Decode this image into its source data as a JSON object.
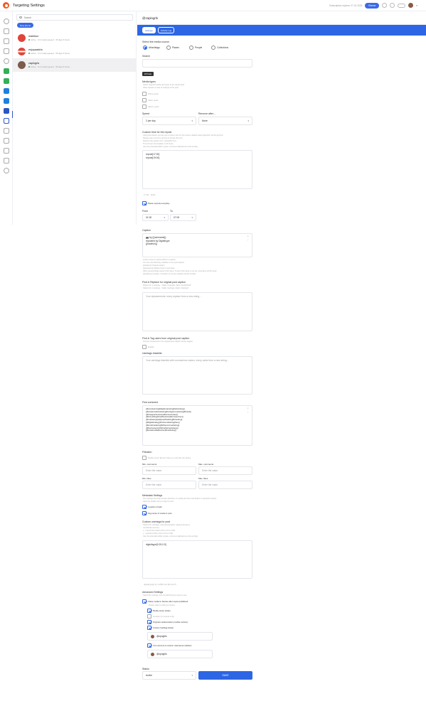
{
  "app": {
    "title": "Targeting Settings",
    "subscription_text": "Subscription expires: 07.01.2025",
    "renew_label": "Renew"
  },
  "colors": {
    "accent": "#2d66e4",
    "brand": "#f15a24",
    "success": "#31b057"
  },
  "sidebar": {
    "icons": [
      "plus-icon",
      "grid-icon",
      "layout-icon",
      "instagram-icon",
      "users-icon",
      "phone-icon",
      "whatsapp-icon",
      "telegram-icon",
      "facebook-icon",
      "messenger-icon",
      "twitter-icon",
      "target-icon",
      "heart-icon",
      "gift-icon",
      "reels-icon",
      "settings-icon"
    ]
  },
  "accounts_panel": {
    "search_placeholder": "Search",
    "add_button": "New phone",
    "items": [
      {
        "name": "malekun",
        "meta": "Active · 6 (in total) queued · 35 days 5 hours"
      },
      {
        "name": "enjoyaadria",
        "meta": "Active · 6 (in total) queued · 35 days 5 hours"
      },
      {
        "name": "zapingrls",
        "meta": "Active · 6 (in total) queued · 35 days 5 hours"
      }
    ]
  },
  "main": {
    "account_title": "@zapingrls",
    "tabs": [
      "Settings",
      "Activity Log"
    ],
    "media_source": {
      "label": "Select the media source:",
      "options": [
        "#Hashtags",
        "Places",
        "People",
        "Collections"
      ]
    },
    "search_label": "Search",
    "chip": "#zTrade",
    "media_types": {
      "label": "Media types",
      "hints": [
        "Select required media and types to the repost feed",
        "Allow reposts in case of settings of the post"
      ],
      "options": [
        "Photo posts",
        "Video posts",
        "Album posts"
      ]
    },
    "speed": {
      "label": "Speed",
      "value": "2 per day"
    },
    "remove_after": {
      "label": "Remove after...",
      "value": "None"
    },
    "custom_time": {
      "label": "Custom time for the repost",
      "hints": [
        "Using the feature you can set a custom time for the repost, default speed algorithm will be ignored",
        "Please enter one time per line in format (hh:mm)",
        "Respect the system time: repost[hh:mm]",
        "Time format: 24 template, 0-23 hours",
        "Use the extended editor syntax, comma is allowed as a line-ending"
      ],
      "value": "repost[17:00]\nrepost[19:00]",
      "note": "17:00 - 19:00"
    },
    "pause": {
      "label": "Pause reposts everyday...",
      "from_label": "From",
      "to_label": "To",
      "from_value": "01:00",
      "to_value": "07:00"
    },
    "caption": {
      "label": "Caption",
      "value": "📷 by {{username}}\nreposted by Digisthype\n{{location}}",
      "hints": [
        "Leave empty to repost without a caption",
        "You can use following variables in the post caption:",
        "{{caption}} Original caption",
        "{{username}} Media owner's username",
        "{{full_name}} Media owner's full name. If user's full name is not set, username will be used",
        "{{location}} Location. If location is not set, location will be omitted"
      ]
    },
    "find_replace": {
      "label": "Find & Replace for original post caption",
      "hints": [
        "Pattern for 1 settings - \"Hello | example | Nice | HelloWorld\"",
        "Pattern for 1 settings - \"Hello | settings | Hello | Settings\""
      ],
      "placeholder": "Your replacements: every replace from a new string..."
    },
    "find_tag": {
      "label": "Find & Tag users from original post caption",
      "hint": "Account mentioned in the original post caption will be tagged",
      "option": "Enable"
    },
    "usertags_blacklist": {
      "label": "Usertags blacklist",
      "placeholder": "Your usertags blacklist with comma/new values, every value from a new string..."
    },
    "first_comment": {
      "label": "First comment",
      "value": "{{#nounlearning|#digitalmarketing|#advertising}}\n{{#socialmediamarketing|#instagrammarketing|#brand}}\n{{#instagrambusiness|#contentcreator}}\n{{#storytelling|#smallbusiness|#entrepreneur}}\n{{#marketingtips|#growthhacking|#branding}}\n{{#digitalstrategy|#onlinemarketing|#seo}}\n{{#emailmarketing|#influencermarketing}}\n{{#businessgrowth|#marketingstrategy}}\n{{#socialmedia|#content|#marketing}}"
    },
    "filtration": {
      "label": "Filtration",
      "option": "Media count: Ensure that you only like the above",
      "min_comments_label": "Min. comments",
      "max_comments_label": "Max. comments",
      "min_likes_label": "Min. likes",
      "max_likes_label": "Max. likes",
      "value_placeholder": "Enter the value"
    },
    "metadata": {
      "label": "Metadata Settings",
      "hints": [
        "The settings can help escape detection on media and from self-detect or reposted content",
        "Save the details that you want to post"
      ],
      "options": [
        "Location of task",
        "Tag owner of media in post"
      ]
    },
    "custom_usertags": {
      "label": "Custom usertags for post",
      "hints": [
        "Pattern for usertags: username/position: @username[x,y]",
        "Coordinate axis key:",
        "x - horizontal position (from 0.0 to 0.99)",
        "y - vertical position (from 0.0 to 0.99)",
        "Use the extended editor syntax, comma is allowed as a line-ending"
      ],
      "value": "digisthype[0.25,0.5]",
      "note": "digisthype[0.1], 0.25[0.1]-0.5[0.1]-0.5"
    },
    "advanced": {
      "label": "Advanced Settings",
      "hint": "Select the settings, then the field that you want to use",
      "main_option": "Share media to Stories after repost published",
      "sub_hint": "Please select a sticky for stories",
      "sub_options": [
        "Media owner sticker",
        "Location (in repost only)",
        "Original media location (mobile version)",
        "Custom hashtag sticker"
      ],
      "sticker_value": "@zpngirls",
      "account_option": "Your account to custom usernames (sticker)",
      "account_value": "@zpngirls"
    },
    "status": {
      "label": "Status",
      "value": "Active"
    },
    "save_label": "SAVE"
  }
}
